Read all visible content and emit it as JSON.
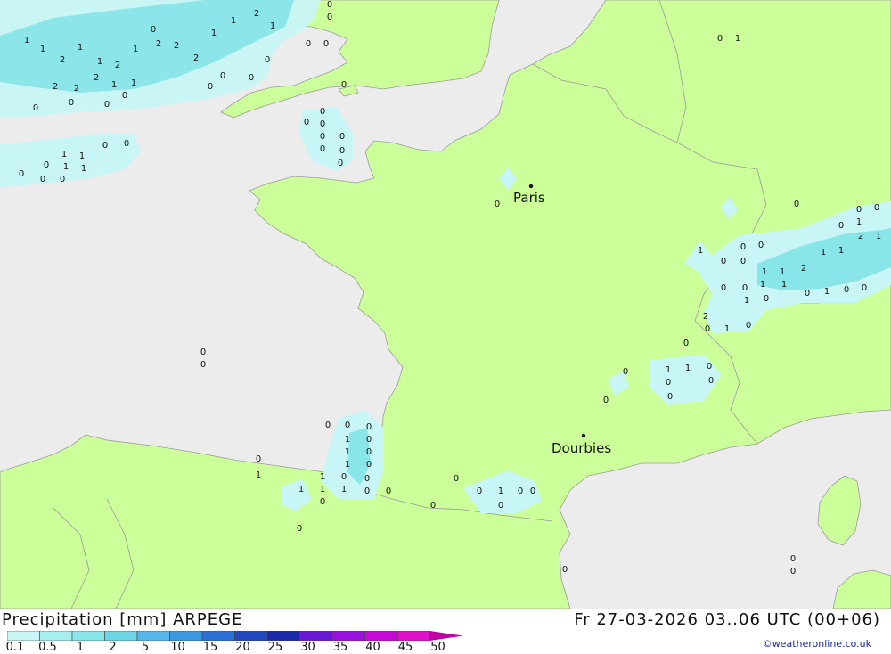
{
  "header": {
    "product": "Precipitation [mm] ARPEGE",
    "valid": "Fr 27-03-2026 03..06 UTC (00+06)"
  },
  "legend": {
    "ticks": [
      "0.1",
      "0.5",
      "1",
      "2",
      "5",
      "10",
      "15",
      "20",
      "25",
      "30",
      "35",
      "40",
      "45",
      "50"
    ],
    "colors": [
      "#c8f5f5",
      "#a8efef",
      "#88e5e8",
      "#6cd6e6",
      "#55b8e8",
      "#3c98e0",
      "#2c70d6",
      "#2248c0",
      "#1a2aa8",
      "#6a18d8",
      "#9a10e0",
      "#c808d8",
      "#e010c8",
      "#c000a0"
    ]
  },
  "credit": "©weatheronline.co.uk",
  "map": {
    "colors": {
      "sea": "#ececec",
      "land": "#ccff99",
      "border": "#9a9a9a"
    },
    "cities": [
      {
        "name": "Paris"
      },
      {
        "name": "Dourbies"
      }
    ],
    "precip_labels": [
      [
        "0",
        "1",
        "1",
        "1",
        "2",
        "1",
        "1",
        "1",
        "1",
        "1",
        "1",
        "1",
        "1",
        "1",
        "2",
        "2",
        "2",
        "2",
        "2",
        "2",
        "1",
        "1",
        "1",
        "1",
        "1"
      ],
      [
        "0",
        "0",
        "0",
        "0",
        "0",
        "0",
        "0",
        "0",
        "1",
        "1",
        "1",
        "1",
        "1",
        "1",
        "1",
        "1",
        "0",
        "0",
        "0",
        "0",
        "0",
        "0",
        "0",
        "0",
        "0"
      ]
    ]
  }
}
